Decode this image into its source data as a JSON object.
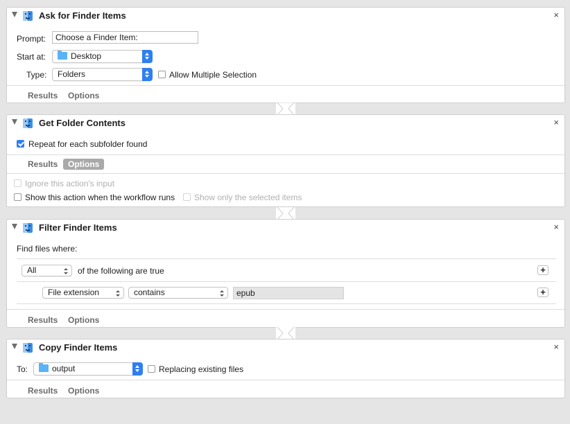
{
  "actions": [
    {
      "title": "Ask for Finder Items",
      "prompt_label": "Prompt:",
      "prompt_value": "Choose a Finder Item:",
      "start_label": "Start at:",
      "start_value": "Desktop",
      "type_label": "Type:",
      "type_value": "Folders",
      "allow_multiple_label": "Allow Multiple Selection",
      "allow_multiple_checked": false,
      "tab_results": "Results",
      "tab_options": "Options"
    },
    {
      "title": "Get Folder Contents",
      "repeat_label": "Repeat for each subfolder found",
      "repeat_checked": true,
      "tab_results": "Results",
      "tab_options": "Options",
      "ignore_input_label": "Ignore this action's input",
      "show_action_label": "Show this action when the workflow runs",
      "show_selected_label": "Show only the selected items"
    },
    {
      "title": "Filter Finder Items",
      "find_label": "Find files where:",
      "match_value": "All",
      "match_suffix": "of the following are true",
      "criteria_attr": "File extension",
      "criteria_op": "contains",
      "criteria_value": "epub",
      "tab_results": "Results",
      "tab_options": "Options"
    },
    {
      "title": "Copy Finder Items",
      "to_label": "To:",
      "to_value": "output",
      "replacing_label": "Replacing existing files",
      "replacing_checked": false,
      "tab_results": "Results",
      "tab_options": "Options"
    }
  ],
  "icons": {
    "close": "×",
    "add": "+"
  },
  "colors": {
    "accent": "#2f7ff0",
    "background": "#e5e5e5"
  }
}
